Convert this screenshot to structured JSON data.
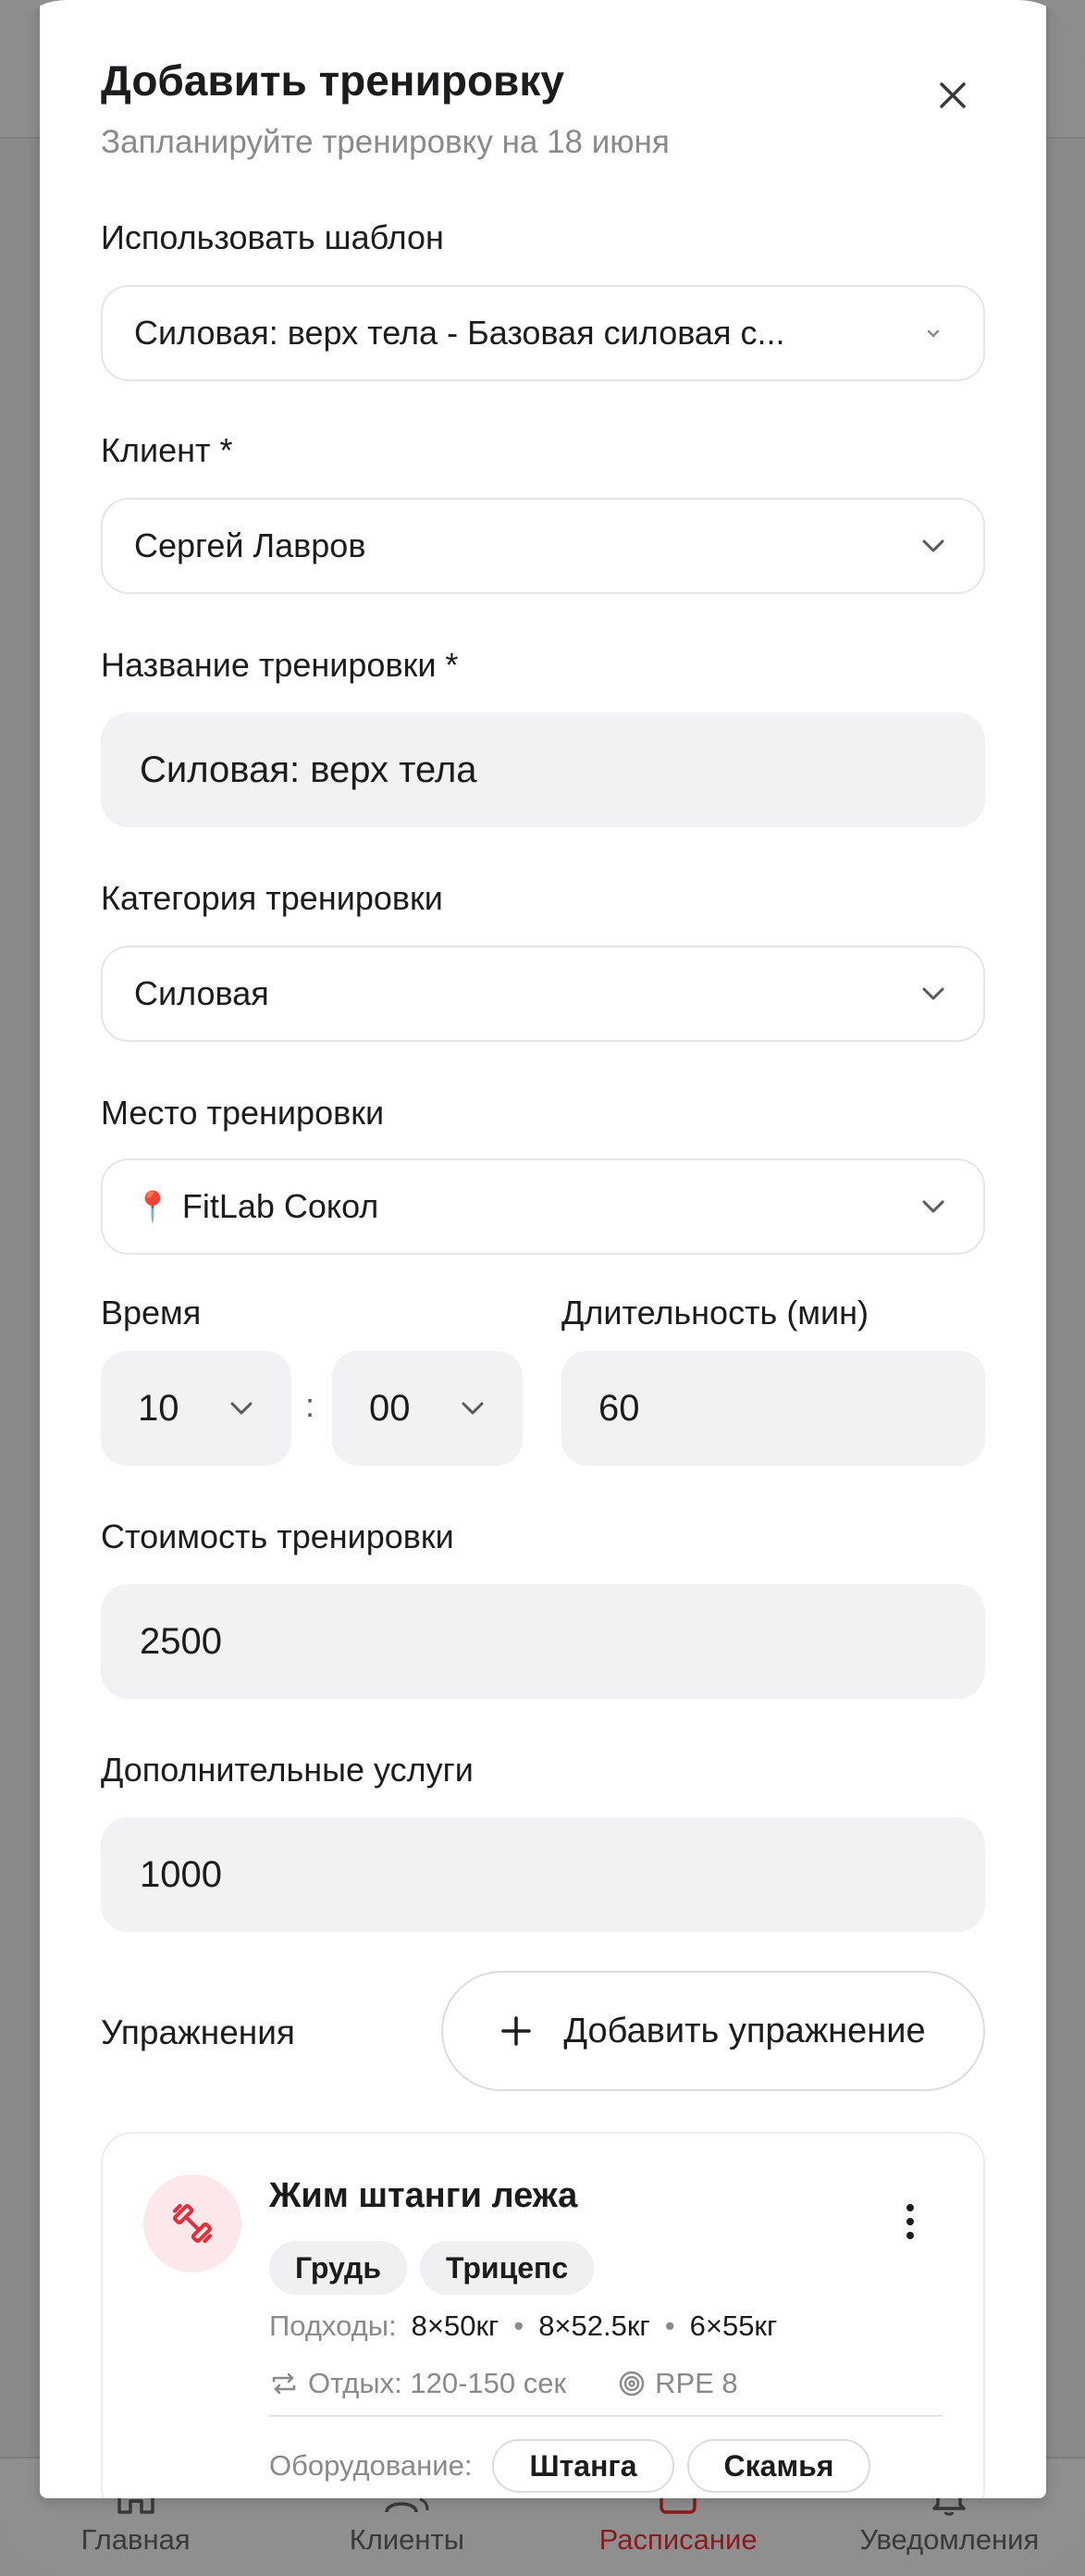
{
  "nav": {
    "items": [
      {
        "label": "Главная"
      },
      {
        "label": "Клиенты"
      },
      {
        "label": "Расписание"
      },
      {
        "label": "Уведомления"
      }
    ],
    "active_color": "#8b1a1f"
  },
  "modal": {
    "title": "Добавить тренировку",
    "subtitle": "Запланируйте тренировку на 18 июня",
    "template": {
      "label": "Использовать шаблон",
      "value": "Силовая: верх тела - Базовая силовая с..."
    },
    "client": {
      "label": "Клиент *",
      "value": "Сергей Лавров"
    },
    "workout_name": {
      "label": "Название тренировки *",
      "value": "Силовая: верх тела"
    },
    "category": {
      "label": "Категория тренировки",
      "value": "Силовая"
    },
    "location": {
      "label": "Место тренировки",
      "pin": "📍",
      "value": "FitLab Сокол"
    },
    "time": {
      "label": "Время",
      "hour": "10",
      "colon": ":",
      "minute": "00"
    },
    "duration": {
      "label": "Длительность (мин)",
      "value": "60"
    },
    "price": {
      "label": "Стоимость тренировки",
      "value": "2500"
    },
    "extra_services": {
      "label": "Дополнительные услуги",
      "value": "1000"
    },
    "exercises": {
      "label": "Упражнения",
      "add_button": "Добавить упражнение",
      "items": [
        {
          "name": "Жим штанги лежа",
          "tags": [
            "Грудь",
            "Трицепс"
          ],
          "sets_label": "Подходы:",
          "sets": [
            "8×50кг",
            "8×52.5кг",
            "6×55кг"
          ],
          "rest": "Отдых: 120-150 сек",
          "rpe": "RPE 8",
          "equipment_label": "Оборудование:",
          "equipment": [
            "Штанга",
            "Скамья"
          ]
        }
      ]
    }
  },
  "colors": {
    "accent": "#e0303c",
    "field_bg": "#f2f2f5"
  }
}
